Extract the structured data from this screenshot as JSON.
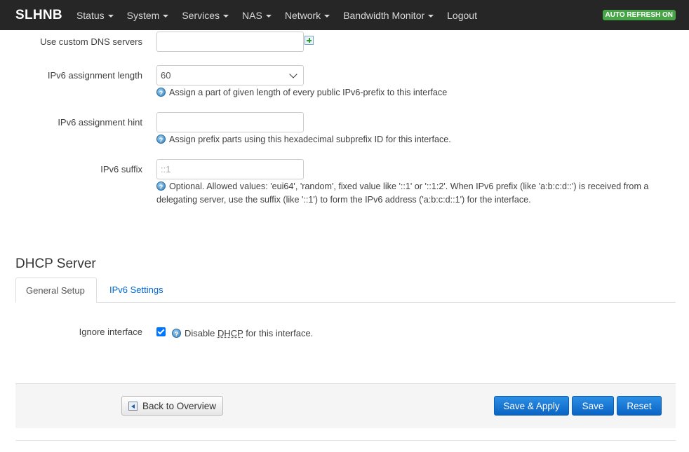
{
  "navbar": {
    "brand": "SLHNB",
    "menus": [
      "Status",
      "System",
      "Services",
      "NAS",
      "Network",
      "Bandwidth Monitor"
    ],
    "logout": "Logout",
    "auto_refresh": "AUTO REFRESH ON"
  },
  "form": {
    "dns_label": "Use custom DNS servers",
    "dns_value": "",
    "ipv6_len_label": "IPv6 assignment length",
    "ipv6_len_value": "60",
    "ipv6_len_help": "Assign a part of given length of every public IPv6-prefix to this interface",
    "ipv6_hint_label": "IPv6 assignment hint",
    "ipv6_hint_value": "",
    "ipv6_hint_help": "Assign prefix parts using this hexadecimal subprefix ID for this interface.",
    "ipv6_suffix_label": "IPv6 suffix",
    "ipv6_suffix_placeholder": "::1",
    "ipv6_suffix_help_1": "Optional. Allowed values: 'eui64', 'random', fixed value like '::1' or '::1:2'. When IPv6 prefix (like 'a:b:c:d::') is received from a",
    "ipv6_suffix_help_2": "delegating server, use the suffix (like '::1') to form the IPv6 address ('a:b:c:d::1') for the interface."
  },
  "dhcp": {
    "title": "DHCP Server",
    "tabs": [
      "General Setup",
      "IPv6 Settings"
    ],
    "ignore_label": "Ignore interface",
    "ignore_checked": true,
    "ignore_help_pre": "Disable ",
    "ignore_help_abbr": "DHCP",
    "ignore_help_post": " for this interface."
  },
  "actions": {
    "back": "Back to Overview",
    "save_apply": "Save & Apply",
    "save": "Save",
    "reset": "Reset"
  }
}
